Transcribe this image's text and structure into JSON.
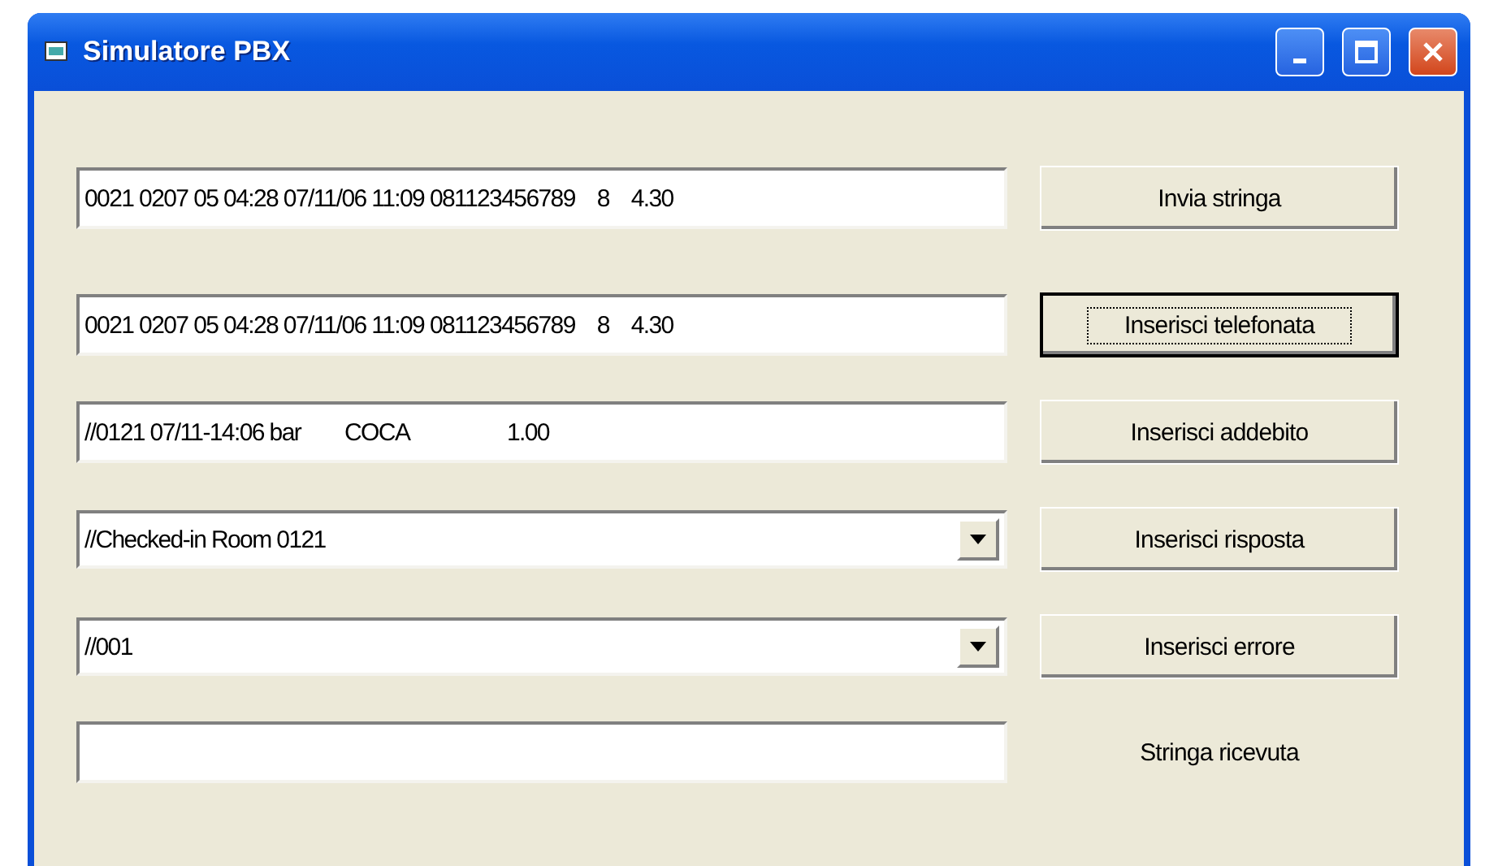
{
  "window": {
    "title": "Simulatore PBX"
  },
  "rows": [
    {
      "field": {
        "kind": "text",
        "value": "0021 0207 05 04:28 07/11/06 11:09 081123456789    8    4.30"
      },
      "action": {
        "kind": "button",
        "label": "Invia stringa",
        "focused": false
      }
    },
    {
      "field": {
        "kind": "text",
        "value": "0021 0207 05 04:28 07/11/06 11:09 081123456789    8    4.30"
      },
      "action": {
        "kind": "button",
        "label": "Inserisci telefonata",
        "focused": true
      }
    },
    {
      "field": {
        "kind": "text",
        "value": "//0121 07/11-14:06 bar        COCA                  1.00"
      },
      "action": {
        "kind": "button",
        "label": "Inserisci addebito",
        "focused": false
      }
    },
    {
      "field": {
        "kind": "combo",
        "value": "//Checked-in Room 0121"
      },
      "action": {
        "kind": "button",
        "label": "Inserisci risposta",
        "focused": false
      }
    },
    {
      "field": {
        "kind": "combo",
        "value": "//001"
      },
      "action": {
        "kind": "button",
        "label": "Inserisci errore",
        "focused": false
      }
    },
    {
      "field": {
        "kind": "text"
      },
      "action": {
        "kind": "label",
        "label": "Stringa ricevuta"
      }
    }
  ]
}
